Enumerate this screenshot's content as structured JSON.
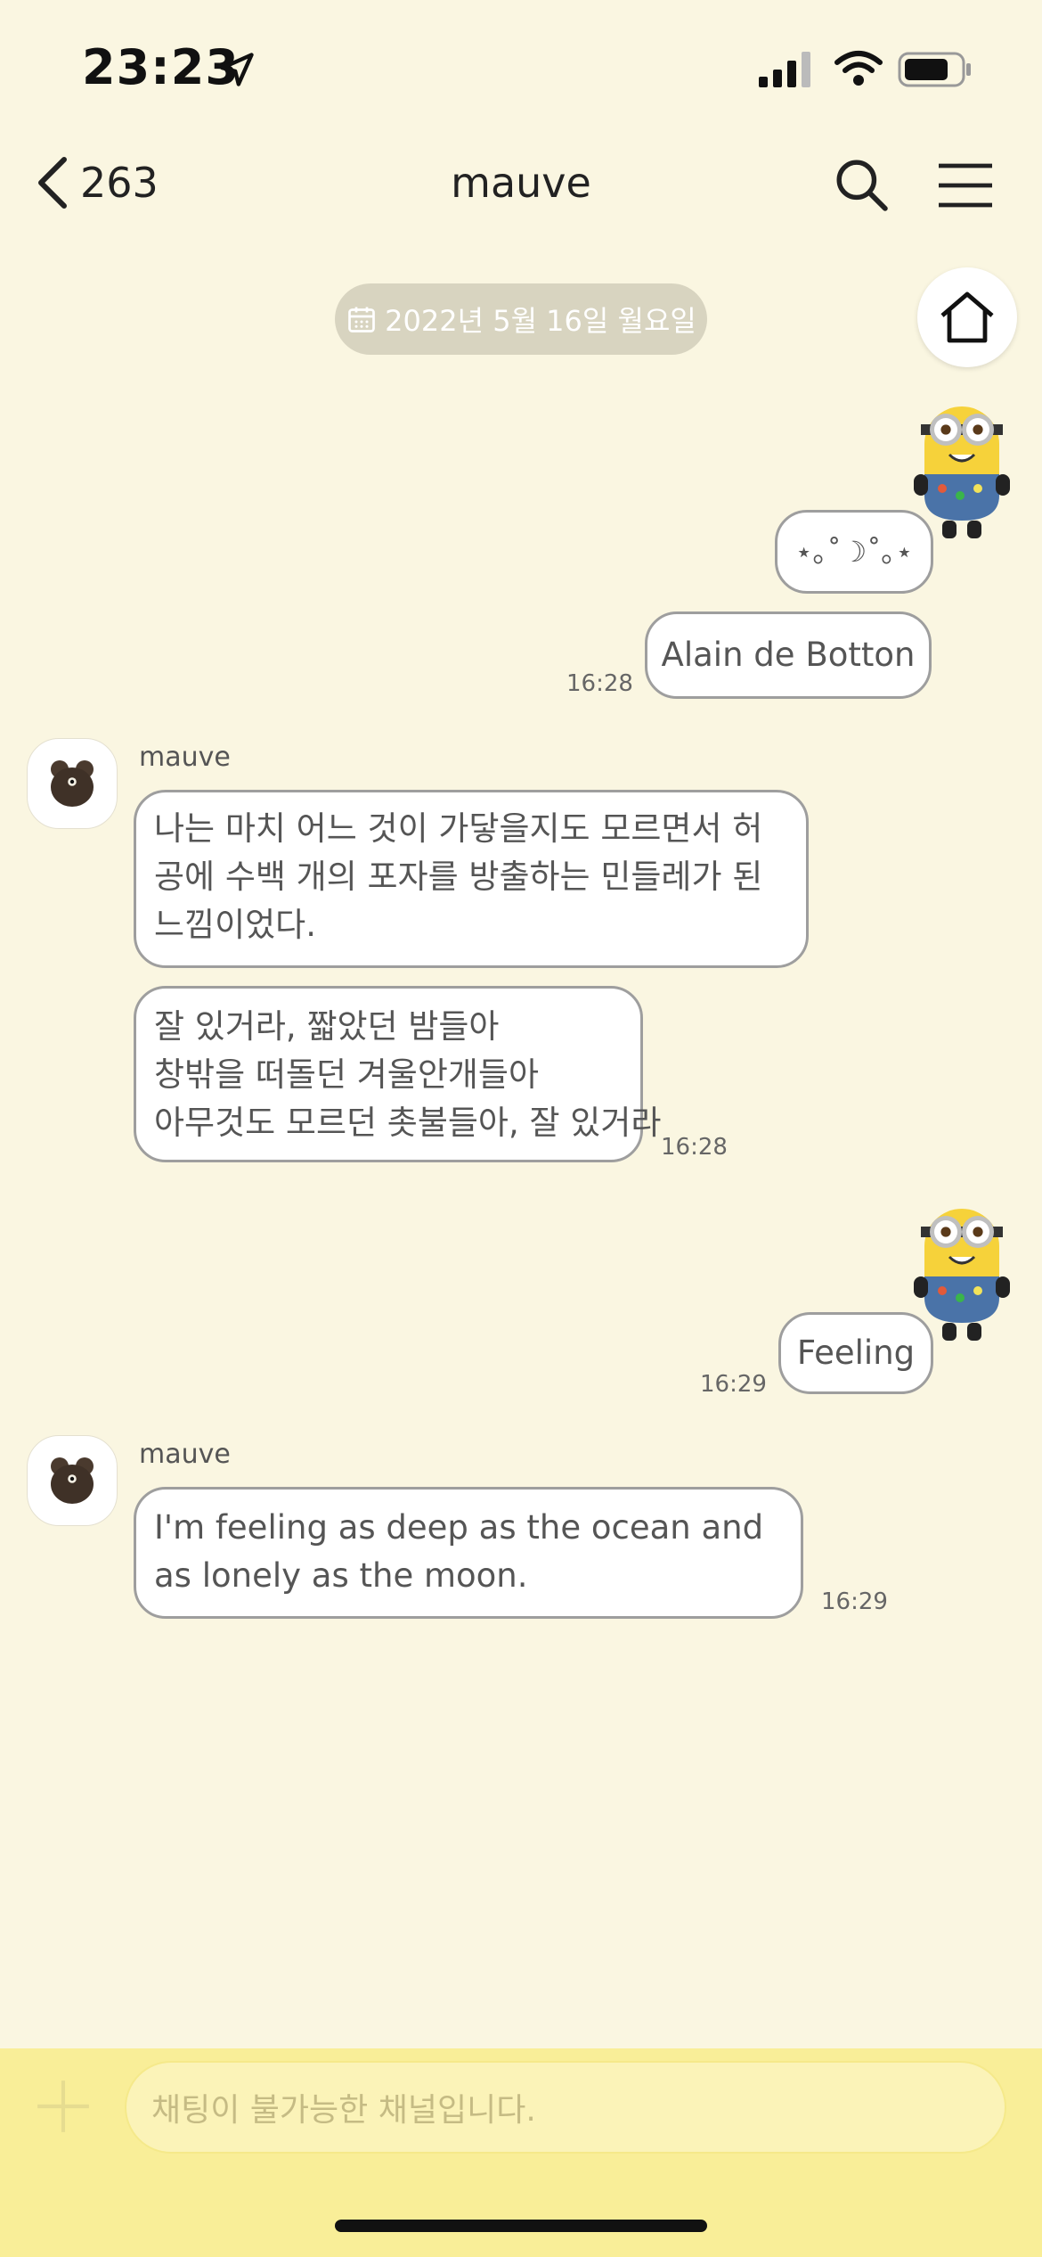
{
  "status_bar": {
    "time": "23:23"
  },
  "header": {
    "back_count": "263",
    "title": "mauve"
  },
  "date_pill": "2022년 5월 16일 월요일",
  "messages": [
    {
      "kind": "sent",
      "text": "⋆｡˚☽˚｡⋆",
      "time": ""
    },
    {
      "kind": "sent",
      "text": "Alain de Botton",
      "time": "16:28"
    },
    {
      "kind": "received",
      "sender": "mauve",
      "text": "나는 마치 어느 것이 가닿을지도 모르면서 허공에 수백 개의 포자를 방출하는 민들레가 된 느낌이었다.",
      "time": ""
    },
    {
      "kind": "received",
      "lines": [
        "잘 있거라, 짧았던 밤들아",
        "창밖을 떠돌던 겨울안개들아",
        "아무것도 모르던 촛불들아, 잘 있거라"
      ],
      "time": "16:28"
    },
    {
      "kind": "sent",
      "text": "Feeling",
      "time": "16:29"
    },
    {
      "kind": "received",
      "sender": "mauve",
      "text": "I'm feeling as deep as the ocean and as lonely as the moon.",
      "time": "16:29"
    }
  ],
  "input": {
    "placeholder": "채팅이 불가능한 채널입니다."
  }
}
